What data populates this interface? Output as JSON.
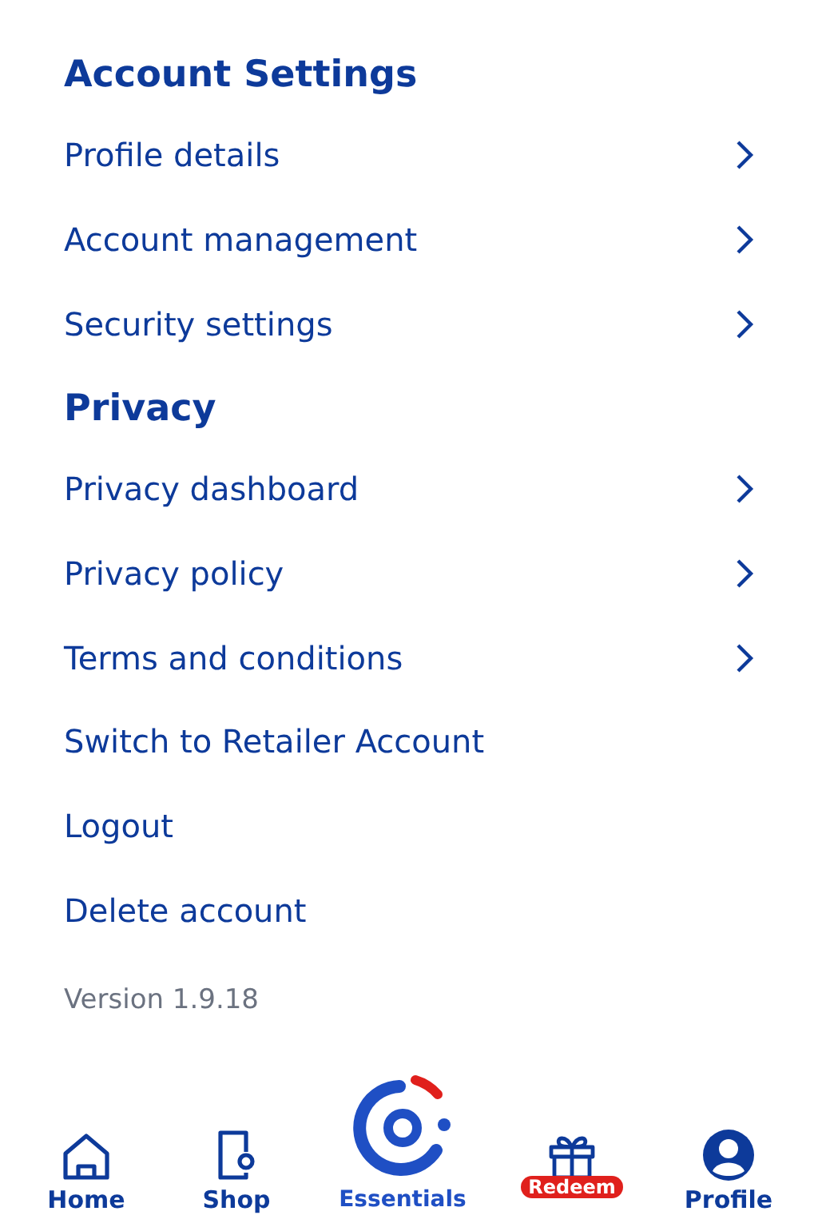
{
  "sections": [
    {
      "title": "Account Settings",
      "items": [
        {
          "label": "Profile details",
          "kind": "link"
        },
        {
          "label": "Account management",
          "kind": "link"
        },
        {
          "label": "Security settings",
          "kind": "link"
        }
      ]
    },
    {
      "title": "Privacy",
      "items": [
        {
          "label": "Privacy dashboard",
          "kind": "link"
        },
        {
          "label": "Privacy policy",
          "kind": "link"
        },
        {
          "label": "Terms and conditions",
          "kind": "link"
        }
      ]
    }
  ],
  "actions": [
    {
      "label": "Switch to Retailer Account"
    },
    {
      "label": "Logout"
    },
    {
      "label": "Delete account"
    }
  ],
  "version": "Version 1.9.18",
  "nav": [
    {
      "kind": "home",
      "label": "Home"
    },
    {
      "kind": "shop",
      "label": "Shop"
    },
    {
      "kind": "essentials",
      "label": "Essentials"
    },
    {
      "kind": "gift",
      "badge": "Redeem"
    },
    {
      "kind": "profile",
      "label": "Profile"
    }
  ]
}
